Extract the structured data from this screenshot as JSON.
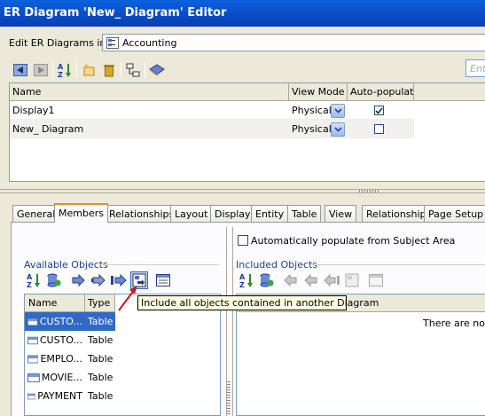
{
  "window": {
    "title": "ER Diagram 'New_ Diagram' Editor"
  },
  "location": {
    "label": "Edit ER Diagrams in:",
    "value": "Accounting"
  },
  "search": {
    "placeholder": "Ent"
  },
  "diagram_grid": {
    "columns": [
      "Name",
      "View Mode",
      "Auto-populate"
    ],
    "rows": [
      {
        "name": "Display1",
        "view_mode": "Physical",
        "auto_populate": true
      },
      {
        "name": "New_ Diagram",
        "view_mode": "Physical",
        "auto_populate": false
      }
    ]
  },
  "tabs": [
    {
      "label": "General",
      "active": false
    },
    {
      "label": "Members",
      "active": true
    },
    {
      "label": "Relationships",
      "active": false
    },
    {
      "label": "Layout",
      "active": false
    },
    {
      "label": "Display",
      "active": false
    },
    {
      "label": "Entity",
      "active": false
    },
    {
      "label": "Table",
      "active": false
    },
    {
      "label": "View",
      "active": false
    },
    {
      "label": "Relationship",
      "active": false
    },
    {
      "label": "Page Setup",
      "active": false
    }
  ],
  "members": {
    "auto_populate_label": "Automatically populate from Subject Area",
    "available_title": "Available Objects",
    "included_title": "Included Objects",
    "available_columns": [
      "Name",
      "Type"
    ],
    "available_rows": [
      {
        "name": "CUSTO...",
        "type": "Table",
        "selected": true
      },
      {
        "name": "CUSTO...",
        "type": "Table",
        "selected": false
      },
      {
        "name": "EMPLO...",
        "type": "Table",
        "selected": false
      },
      {
        "name": "MOVIE...",
        "type": "Table",
        "selected": false
      },
      {
        "name": "PAYMENT",
        "type": "Table",
        "selected": false
      }
    ],
    "included_empty": "There are no it",
    "tooltip": "Include all objects contained in another Diagram"
  }
}
